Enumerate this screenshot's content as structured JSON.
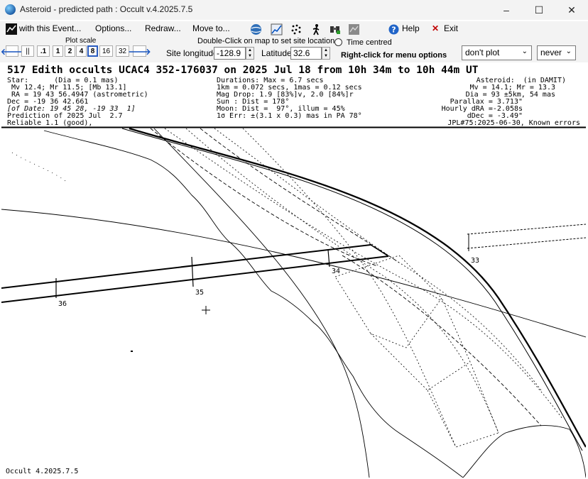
{
  "window": {
    "title": "Asteroid - predicted path : Occult v.4.2025.7.5",
    "minimize": "–",
    "maximize": "☐",
    "close": "✕"
  },
  "menu": {
    "event": "with this Event...",
    "options": "Options...",
    "redraw": "Redraw...",
    "moveto": "Move to...",
    "help": "Help",
    "exit": "Exit",
    "icons": [
      "globe-icon",
      "chart-icon",
      "dots-icon",
      "walker-icon",
      "binoculars-icon",
      "map-icon"
    ]
  },
  "toolbar": {
    "plot_scale_label": "Plot scale",
    "buttons": [
      ".1",
      "1",
      "2",
      "4",
      "8",
      "16",
      "32"
    ],
    "selected_scale": "8",
    "hint": "Double-Click on map to set site location",
    "time_centred": "Time centred",
    "site_longitude_label": "Site longitude",
    "site_longitude": "-128.9",
    "latitude_label": "Latitude",
    "latitude": "32.6",
    "right_click": "Right-click for menu options",
    "plot_select": "don't plot",
    "never_select": "never"
  },
  "plot": {
    "title": "517 Edith occults UCAC4 352-176037 on 2025 Jul 18 from 10h 34m to 10h 44m UT",
    "col1": [
      "Star:      (Dia = 0.1 mas)",
      " Mv 12.4; Mr 11.5; [Mb 13.1]",
      " RA = 19 43 56.4947 (astrometric)",
      "Dec = -19 36 42.661",
      "[of Date: 19 45 28, -19 33  1]",
      "Prediction of 2025 Jul  2.7",
      "Reliable 1.1 (good),"
    ],
    "col2": [
      "Durations: Max = 6.7 secs",
      "1km = 0.072 secs, 1mas = 0.12 secs",
      "Mag Drop: 1.9 [83%]v, 2.0 [84%]r",
      "Sun : Dist = 178°",
      "Moon: Dist =  97°, illum = 45%",
      "1σ Err: ±(3.1 x 0.3) mas in PA 78°"
    ],
    "col3": [
      "Asteroid:  (in DAMIT)",
      "Mv = 14.1; Mr = 13.3",
      "Dia = 93 ±5km, 54 mas",
      "Parallax = 3.713\"",
      "Hourly dRA =-2.058s",
      "dDec = -3.49\"",
      "JPL#75:2025-06-30, Known errors"
    ],
    "time_labels": [
      "33",
      "34",
      "35",
      "36"
    ],
    "footer": "Occult 4.2025.7.5"
  }
}
